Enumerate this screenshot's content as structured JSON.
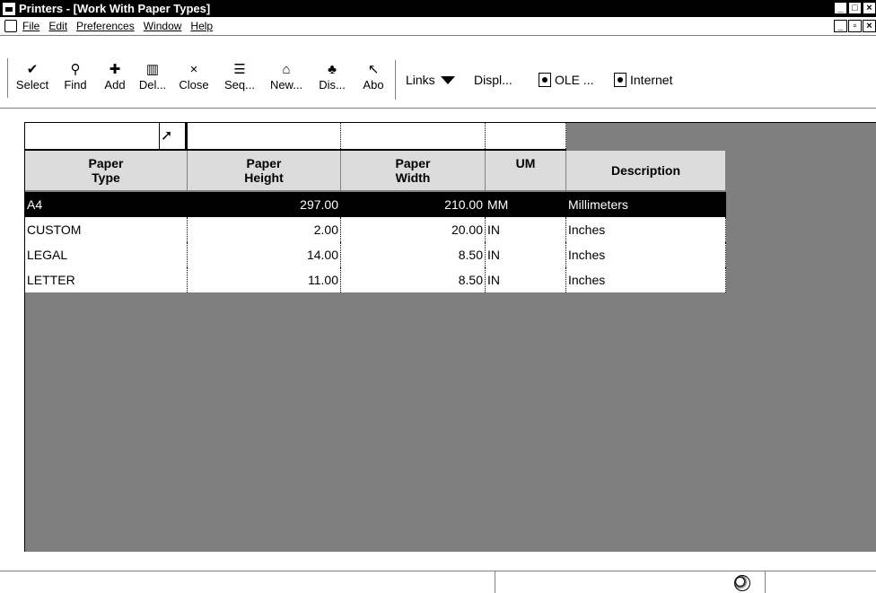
{
  "window": {
    "title": "Printers - [Work With Paper Types]"
  },
  "menu": {
    "items": [
      "File",
      "Edit",
      "Preferences",
      "Window",
      "Help"
    ]
  },
  "toolbar": {
    "buttons": [
      {
        "label": "Select",
        "icon": "check-icon",
        "glyph": "✔"
      },
      {
        "label": "Find",
        "icon": "find-icon",
        "glyph": "🔍"
      },
      {
        "label": "Add",
        "icon": "add-icon",
        "glyph": "✚"
      },
      {
        "label": "Del...",
        "icon": "trash-icon",
        "glyph": "🗑"
      },
      {
        "label": "Close",
        "icon": "close-icon",
        "glyph": "×"
      },
      {
        "label": "Seq...",
        "icon": "sequence-icon",
        "glyph": "☰"
      },
      {
        "label": "New...",
        "icon": "new-icon",
        "glyph": "⌂"
      },
      {
        "label": "Dis...",
        "icon": "display-icon",
        "glyph": "♣"
      },
      {
        "label": "Abo",
        "icon": "about-icon",
        "glyph": "↖"
      }
    ],
    "links_label": "Links",
    "display_label": "Displ...",
    "ole_label": "OLE ...",
    "internet_label": "Internet"
  },
  "grid": {
    "columns": [
      {
        "key": "type",
        "label": "Paper\nType"
      },
      {
        "key": "height",
        "label": "Paper\nHeight"
      },
      {
        "key": "width",
        "label": "Paper\nWidth"
      },
      {
        "key": "um",
        "label": "UM"
      },
      {
        "key": "desc",
        "label": "Description"
      }
    ],
    "rows": [
      {
        "type": "A4",
        "height": "297.00",
        "width": "210.00",
        "um": "MM",
        "desc": "Millimeters",
        "selected": true
      },
      {
        "type": "CUSTOM",
        "height": "2.00",
        "width": "20.00",
        "um": "IN",
        "desc": "Inches",
        "selected": false
      },
      {
        "type": "LEGAL",
        "height": "14.00",
        "width": "8.50",
        "um": "IN",
        "desc": "Inches",
        "selected": false
      },
      {
        "type": "LETTER",
        "height": "11.00",
        "width": "8.50",
        "um": "IN",
        "desc": "Inches",
        "selected": false
      }
    ]
  }
}
